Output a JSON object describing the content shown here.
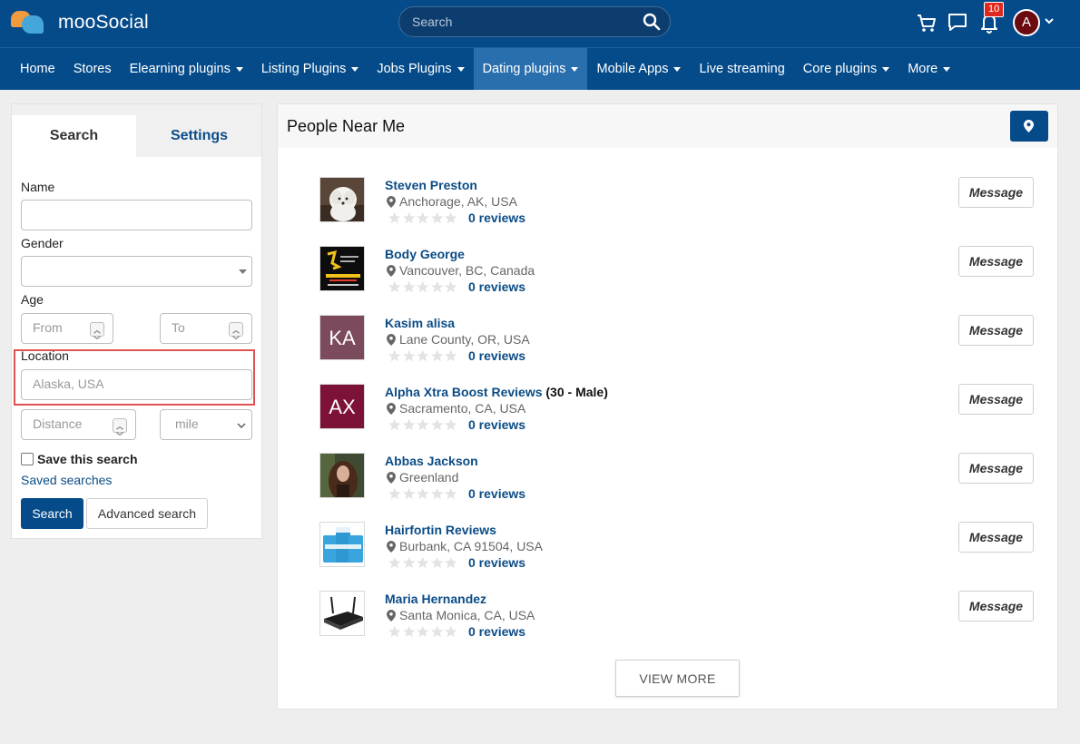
{
  "header": {
    "logo_text": "mooSocial",
    "search_placeholder": "Search",
    "notification_count": "10",
    "avatar_initial": "A"
  },
  "nav": {
    "items": [
      {
        "label": "Home",
        "dropdown": false
      },
      {
        "label": "Stores",
        "dropdown": false
      },
      {
        "label": "Elearning plugins",
        "dropdown": true
      },
      {
        "label": "Listing Plugins",
        "dropdown": true
      },
      {
        "label": "Jobs Plugins",
        "dropdown": true
      },
      {
        "label": "Dating plugins",
        "dropdown": true,
        "active": true
      },
      {
        "label": "Mobile Apps",
        "dropdown": true
      },
      {
        "label": "Live streaming",
        "dropdown": false
      },
      {
        "label": "Core plugins",
        "dropdown": true
      },
      {
        "label": "More",
        "dropdown": true
      }
    ]
  },
  "sidebar": {
    "tabs": [
      "Search",
      "Settings"
    ],
    "name_label": "Name",
    "gender_label": "Gender",
    "age_label": "Age",
    "age_from_placeholder": "From",
    "age_to_placeholder": "To",
    "location_label": "Location",
    "location_placeholder": "Alaska, USA",
    "distance_placeholder": "Distance",
    "unit_value": "mile",
    "save_search_label": "Save this search",
    "saved_searches_link": "Saved searches",
    "search_button": "Search",
    "advanced_button": "Advanced search"
  },
  "main": {
    "title": "People Near Me",
    "message_label": "Message",
    "view_more": "VIEW MORE",
    "people": [
      {
        "name": "Steven Preston",
        "extra": "",
        "location": "Anchorage, AK, USA",
        "reviews": "0 reviews",
        "rating": 0,
        "avatar": "photo-dog"
      },
      {
        "name": "Body George",
        "extra": "",
        "location": "Vancouver, BC, Canada",
        "reviews": "0 reviews",
        "rating": 0,
        "avatar": "photo-logo"
      },
      {
        "name": "Kasim alisa",
        "extra": "",
        "location": "Lane County, OR, USA",
        "reviews": "0 reviews",
        "rating": 0,
        "avatar": "initials",
        "initials": "KA",
        "color": "#7b4a5c"
      },
      {
        "name": "Alpha Xtra Boost Reviews",
        "extra": "(30 - Male)",
        "location": "Sacramento, CA, USA",
        "reviews": "0 reviews",
        "rating": 0,
        "avatar": "initials",
        "initials": "AX",
        "color": "#7d1238"
      },
      {
        "name": "Abbas Jackson",
        "extra": "",
        "location": "Greenland",
        "reviews": "0 reviews",
        "rating": 0,
        "avatar": "photo-woman"
      },
      {
        "name": "Hairfortin Reviews",
        "extra": "",
        "location": "Burbank, CA 91504, USA",
        "reviews": "0 reviews",
        "rating": 0,
        "avatar": "photo-bottles"
      },
      {
        "name": "Maria Hernandez",
        "extra": "",
        "location": "Santa Monica, CA, USA",
        "reviews": "0 reviews",
        "rating": 0,
        "avatar": "photo-router"
      }
    ]
  },
  "colors": {
    "brand": "#054b8a",
    "active_nav": "#2a6fad",
    "link": "#0b4c86",
    "highlight": "#e05252"
  }
}
